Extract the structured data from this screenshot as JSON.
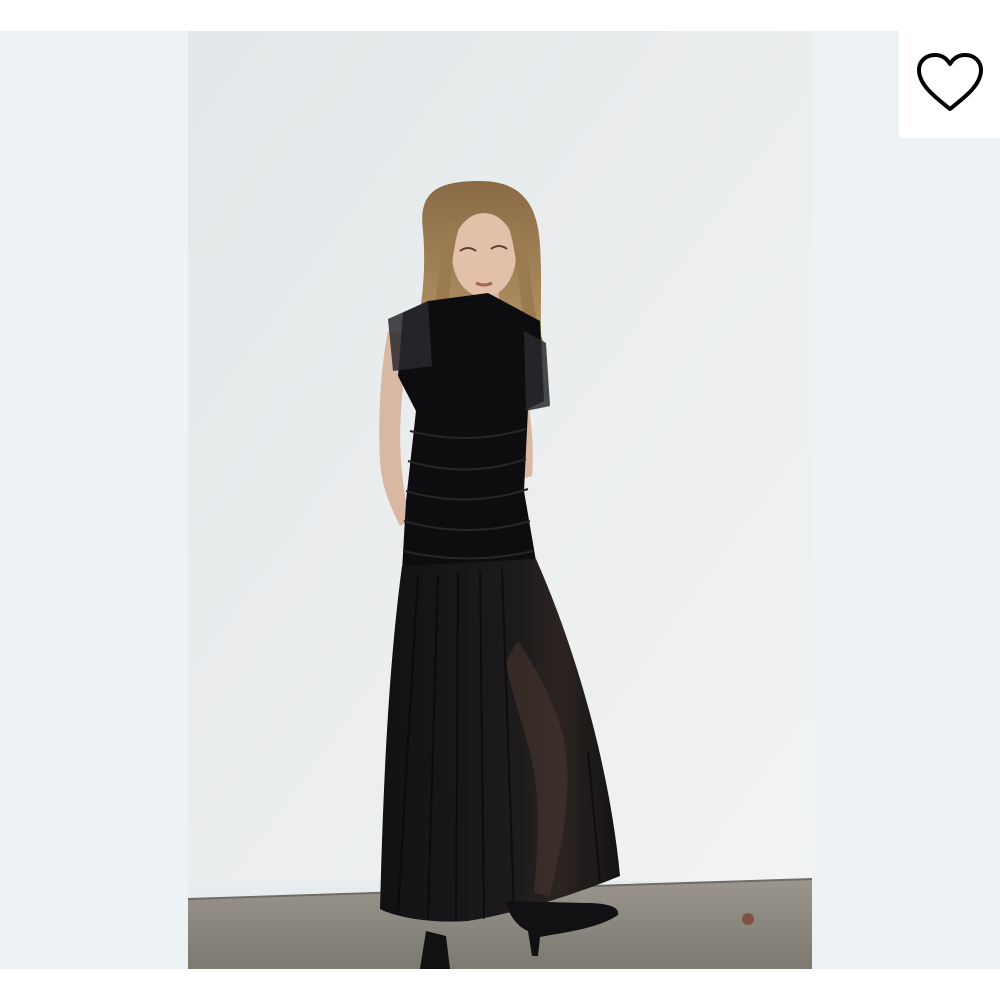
{
  "product_image": {
    "alt": "",
    "icon": "product-photo"
  },
  "favorite": {
    "icon": "heart-outline-icon",
    "color": "#000000"
  },
  "colors": {
    "page_background": "#ffffff",
    "side_panel": "#edf2f5",
    "wall": "#e9ecee",
    "floor": "#8a8780",
    "dress": "#0d0d0f"
  }
}
